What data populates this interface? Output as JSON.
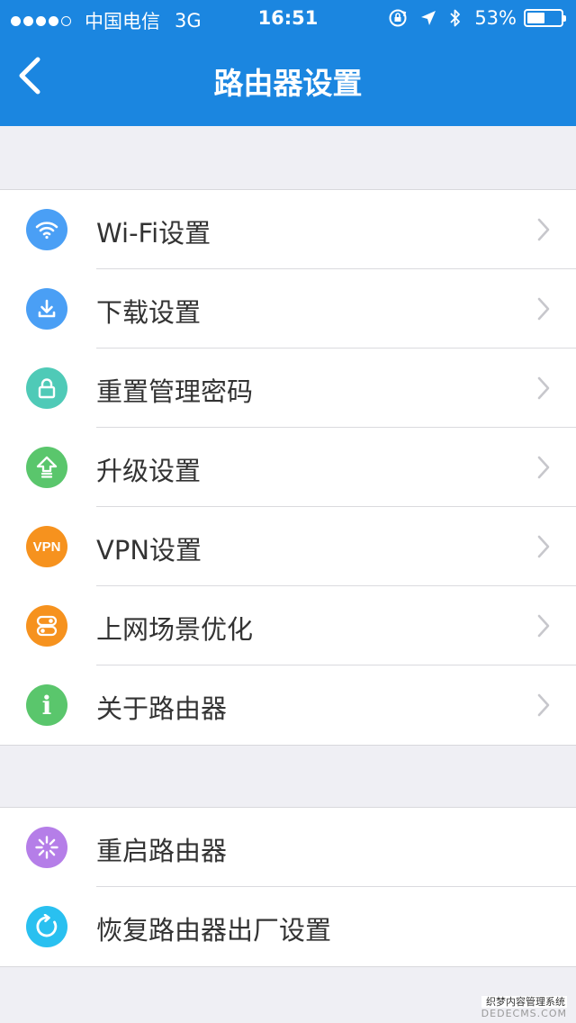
{
  "status": {
    "carrier": "中国电信",
    "network": "3G",
    "time": "16:51",
    "battery_text": "53%",
    "battery_level": 0.53,
    "signal_bars_filled": 4,
    "signal_bars_total": 5
  },
  "header": {
    "title": "路由器设置",
    "color": "#1b86e0"
  },
  "settings": {
    "items": [
      {
        "label": "Wi-Fi设置",
        "icon": "wifi-icon",
        "color": "#4a9ff5"
      },
      {
        "label": "下载设置",
        "icon": "download-icon",
        "color": "#4a9ff5"
      },
      {
        "label": "重置管理密码",
        "icon": "lock-icon",
        "color": "#4fcab7"
      },
      {
        "label": "升级设置",
        "icon": "upgrade-icon",
        "color": "#5ac66c"
      },
      {
        "label": "VPN设置",
        "icon": "vpn-icon",
        "icon_text": "VPN",
        "color": "#f6921e"
      },
      {
        "label": "上网场景优化",
        "icon": "toggle-icon",
        "color": "#f6921e"
      },
      {
        "label": "关于路由器",
        "icon": "info-icon",
        "icon_text": "i",
        "color": "#5ac66c"
      }
    ]
  },
  "actions": {
    "items": [
      {
        "label": "重启路由器",
        "icon": "restart-icon",
        "color": "#b57ee8"
      },
      {
        "label": "恢复路由器出厂设置",
        "icon": "reset-icon",
        "color": "#29c0f0"
      }
    ]
  },
  "watermark": {
    "line1": "织梦内容管理系统",
    "line2": "DEDECMS.COM"
  }
}
